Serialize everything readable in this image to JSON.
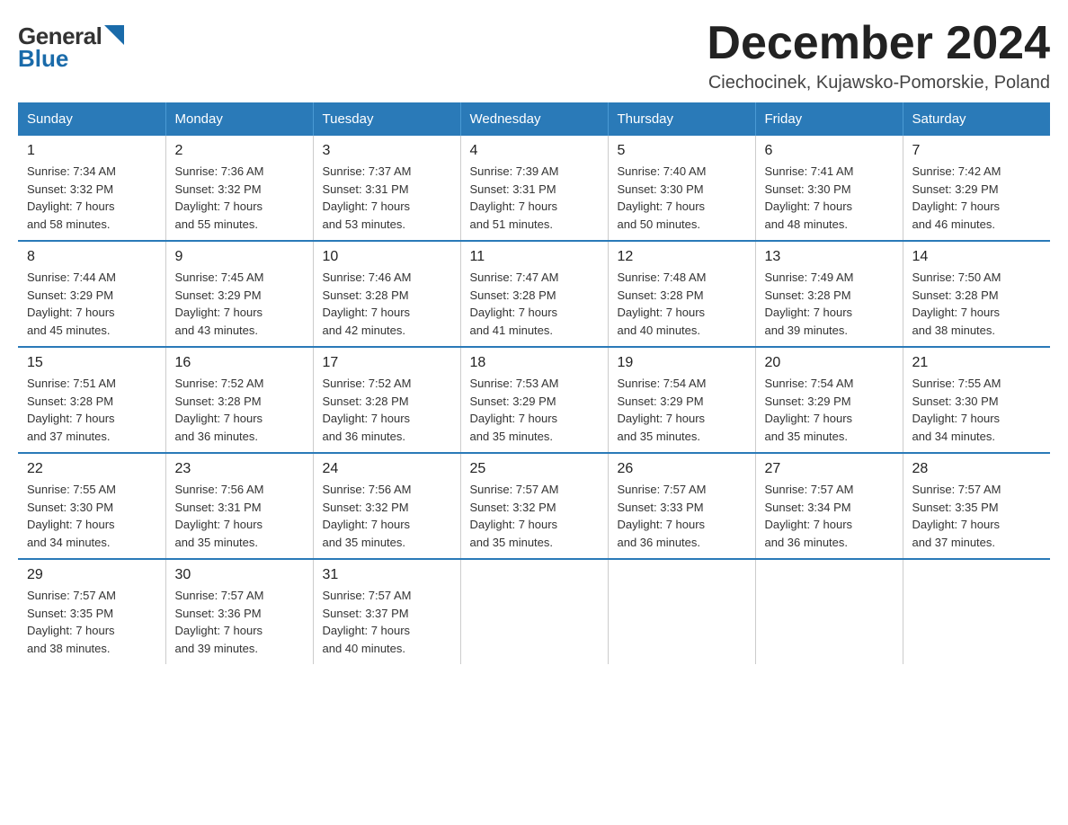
{
  "logo": {
    "general": "General",
    "blue": "Blue",
    "triangle": "▶"
  },
  "title": "December 2024",
  "location": "Ciechocinek, Kujawsko-Pomorskie, Poland",
  "columns": [
    "Sunday",
    "Monday",
    "Tuesday",
    "Wednesday",
    "Thursday",
    "Friday",
    "Saturday"
  ],
  "weeks": [
    [
      {
        "day": "1",
        "sunrise": "7:34 AM",
        "sunset": "3:32 PM",
        "daylight": "7 hours and 58 minutes."
      },
      {
        "day": "2",
        "sunrise": "7:36 AM",
        "sunset": "3:32 PM",
        "daylight": "7 hours and 55 minutes."
      },
      {
        "day": "3",
        "sunrise": "7:37 AM",
        "sunset": "3:31 PM",
        "daylight": "7 hours and 53 minutes."
      },
      {
        "day": "4",
        "sunrise": "7:39 AM",
        "sunset": "3:31 PM",
        "daylight": "7 hours and 51 minutes."
      },
      {
        "day": "5",
        "sunrise": "7:40 AM",
        "sunset": "3:30 PM",
        "daylight": "7 hours and 50 minutes."
      },
      {
        "day": "6",
        "sunrise": "7:41 AM",
        "sunset": "3:30 PM",
        "daylight": "7 hours and 48 minutes."
      },
      {
        "day": "7",
        "sunrise": "7:42 AM",
        "sunset": "3:29 PM",
        "daylight": "7 hours and 46 minutes."
      }
    ],
    [
      {
        "day": "8",
        "sunrise": "7:44 AM",
        "sunset": "3:29 PM",
        "daylight": "7 hours and 45 minutes."
      },
      {
        "day": "9",
        "sunrise": "7:45 AM",
        "sunset": "3:29 PM",
        "daylight": "7 hours and 43 minutes."
      },
      {
        "day": "10",
        "sunrise": "7:46 AM",
        "sunset": "3:28 PM",
        "daylight": "7 hours and 42 minutes."
      },
      {
        "day": "11",
        "sunrise": "7:47 AM",
        "sunset": "3:28 PM",
        "daylight": "7 hours and 41 minutes."
      },
      {
        "day": "12",
        "sunrise": "7:48 AM",
        "sunset": "3:28 PM",
        "daylight": "7 hours and 40 minutes."
      },
      {
        "day": "13",
        "sunrise": "7:49 AM",
        "sunset": "3:28 PM",
        "daylight": "7 hours and 39 minutes."
      },
      {
        "day": "14",
        "sunrise": "7:50 AM",
        "sunset": "3:28 PM",
        "daylight": "7 hours and 38 minutes."
      }
    ],
    [
      {
        "day": "15",
        "sunrise": "7:51 AM",
        "sunset": "3:28 PM",
        "daylight": "7 hours and 37 minutes."
      },
      {
        "day": "16",
        "sunrise": "7:52 AM",
        "sunset": "3:28 PM",
        "daylight": "7 hours and 36 minutes."
      },
      {
        "day": "17",
        "sunrise": "7:52 AM",
        "sunset": "3:28 PM",
        "daylight": "7 hours and 36 minutes."
      },
      {
        "day": "18",
        "sunrise": "7:53 AM",
        "sunset": "3:29 PM",
        "daylight": "7 hours and 35 minutes."
      },
      {
        "day": "19",
        "sunrise": "7:54 AM",
        "sunset": "3:29 PM",
        "daylight": "7 hours and 35 minutes."
      },
      {
        "day": "20",
        "sunrise": "7:54 AM",
        "sunset": "3:29 PM",
        "daylight": "7 hours and 35 minutes."
      },
      {
        "day": "21",
        "sunrise": "7:55 AM",
        "sunset": "3:30 PM",
        "daylight": "7 hours and 34 minutes."
      }
    ],
    [
      {
        "day": "22",
        "sunrise": "7:55 AM",
        "sunset": "3:30 PM",
        "daylight": "7 hours and 34 minutes."
      },
      {
        "day": "23",
        "sunrise": "7:56 AM",
        "sunset": "3:31 PM",
        "daylight": "7 hours and 35 minutes."
      },
      {
        "day": "24",
        "sunrise": "7:56 AM",
        "sunset": "3:32 PM",
        "daylight": "7 hours and 35 minutes."
      },
      {
        "day": "25",
        "sunrise": "7:57 AM",
        "sunset": "3:32 PM",
        "daylight": "7 hours and 35 minutes."
      },
      {
        "day": "26",
        "sunrise": "7:57 AM",
        "sunset": "3:33 PM",
        "daylight": "7 hours and 36 minutes."
      },
      {
        "day": "27",
        "sunrise": "7:57 AM",
        "sunset": "3:34 PM",
        "daylight": "7 hours and 36 minutes."
      },
      {
        "day": "28",
        "sunrise": "7:57 AM",
        "sunset": "3:35 PM",
        "daylight": "7 hours and 37 minutes."
      }
    ],
    [
      {
        "day": "29",
        "sunrise": "7:57 AM",
        "sunset": "3:35 PM",
        "daylight": "7 hours and 38 minutes."
      },
      {
        "day": "30",
        "sunrise": "7:57 AM",
        "sunset": "3:36 PM",
        "daylight": "7 hours and 39 minutes."
      },
      {
        "day": "31",
        "sunrise": "7:57 AM",
        "sunset": "3:37 PM",
        "daylight": "7 hours and 40 minutes."
      },
      null,
      null,
      null,
      null
    ]
  ],
  "labels": {
    "sunrise": "Sunrise:",
    "sunset": "Sunset:",
    "daylight": "Daylight:"
  }
}
